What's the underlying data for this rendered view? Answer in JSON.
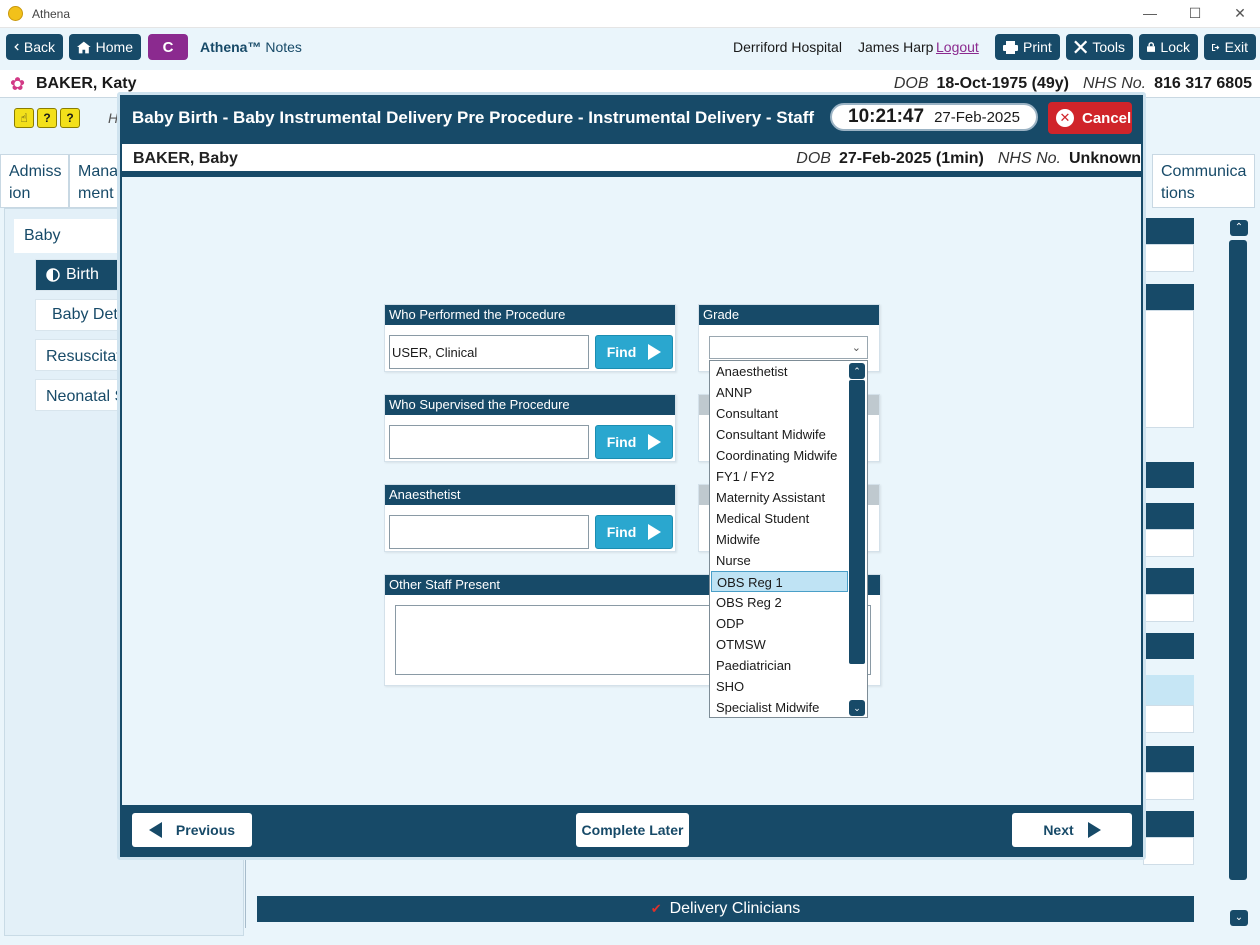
{
  "window": {
    "title": "Athena"
  },
  "toolbar": {
    "back": "Back",
    "home": "Home",
    "c_badge": "C",
    "app_name": "Athena™",
    "app_module": "Notes",
    "hospital": "Derriford Hospital",
    "user": "James Harp",
    "logout": "Logout",
    "print": "Print",
    "tools": "Tools",
    "lock": "Lock",
    "exit": "Exit"
  },
  "patient": {
    "name": "BAKER, Katy",
    "dob_label": "DOB",
    "dob": "18-Oct-1975 (49y)",
    "nhs_label": "NHS No.",
    "nhs": "816 317 6805"
  },
  "background": {
    "h_stub": "H",
    "tabs": [
      {
        "label": "Admiss ion"
      },
      {
        "label": "Mana ment"
      },
      {
        "label": "Communica tions"
      }
    ],
    "nav": {
      "group": "Baby",
      "items": [
        "Birth",
        "Baby Det",
        "Resuscitatio",
        "Neonatal S"
      ]
    },
    "delivery_clinicians": "Delivery Clinicians"
  },
  "modal": {
    "title": "Baby Birth - Baby Instrumental Delivery Pre Procedure - Instrumental Delivery - Staff",
    "time": "10:21:47",
    "date": "27-Feb-2025",
    "cancel": "Cancel",
    "baby": {
      "name": "BAKER, Baby",
      "dob_label": "DOB",
      "dob": "27-Feb-2025 (1min)",
      "nhs_label": "NHS No.",
      "nhs": "Unknown"
    },
    "sections": {
      "performed": {
        "label": "Who Performed the Procedure",
        "value": "USER, Clinical",
        "find": "Find"
      },
      "supervised": {
        "label": "Who Supervised the Procedure",
        "value": "",
        "find": "Find"
      },
      "anaesthetist": {
        "label": "Anaesthetist",
        "value": "",
        "find": "Find"
      },
      "other_staff": {
        "label": "Other Staff Present",
        "value": ""
      }
    },
    "grade": {
      "label": "Grade",
      "selected": "",
      "options": [
        "Anaesthetist",
        "ANNP",
        "Consultant",
        "Consultant Midwife",
        "Coordinating Midwife",
        "FY1 / FY2",
        "Maternity Assistant",
        "Medical Student",
        "Midwife",
        "Nurse",
        "OBS Reg 1",
        "OBS Reg 2",
        "ODP",
        "OTMSW",
        "Paediatrician",
        "SHO",
        "Specialist Midwife"
      ],
      "highlighted": "OBS Reg 1"
    },
    "footer": {
      "previous": "Previous",
      "complete_later": "Complete Later",
      "next": "Next"
    }
  },
  "colors": {
    "navy": "#174a68",
    "find": "#2aa7cf",
    "cancel": "#d0242a",
    "c_badge": "#8b2a8f",
    "highlight": "#bfe3f4"
  }
}
